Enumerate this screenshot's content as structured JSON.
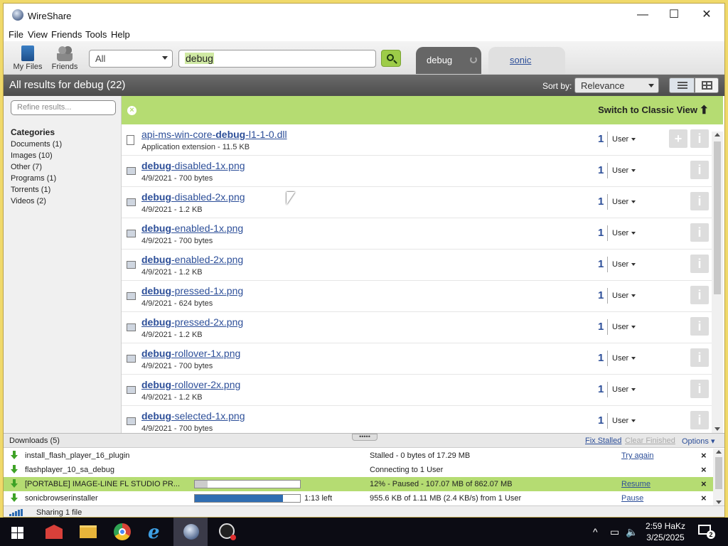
{
  "window": {
    "title": "WireShare",
    "minimize_icon": "—",
    "maximize_icon": "☐",
    "close_icon": "✕"
  },
  "menu": [
    "File",
    "View",
    "Friends",
    "Tools",
    "Help"
  ],
  "toolbar": {
    "my_files_label": "My Files",
    "friends_label": "Friends",
    "filter_value": "All",
    "search_value": "debug",
    "tabs": [
      {
        "label": "debug"
      },
      {
        "label": "sonic"
      }
    ]
  },
  "results_header": {
    "title": "All results for debug (22)",
    "sort_label": "Sort by:",
    "sort_value": "Relevance"
  },
  "sidebar": {
    "refine_placeholder": "Refine results...",
    "categories_title": "Categories",
    "categories": [
      "Documents (1)",
      "Images (10)",
      "Other (7)",
      "Programs (1)",
      "Torrents (1)",
      "Videos (2)"
    ]
  },
  "classic_bar": {
    "label": "Switch to Classic View",
    "close_icon": "×",
    "arrow_icon": "⬆"
  },
  "results": [
    {
      "pre": "api-ms-win-core-",
      "bold": "debug",
      "post": "-l1-1-0.dll",
      "meta": "Application extension - 11.5 KB",
      "count": "1",
      "user": "User",
      "kind": "doc",
      "has_add": true
    },
    {
      "pre": "",
      "bold": "debug",
      "post": "-disabled-1x.png",
      "meta": "4/9/2021 - 700 bytes",
      "count": "1",
      "user": "User",
      "kind": "img",
      "has_add": false
    },
    {
      "pre": "",
      "bold": "debug",
      "post": "-disabled-2x.png",
      "meta": "4/9/2021 - 1.2 KB",
      "count": "1",
      "user": "User",
      "kind": "img",
      "has_add": false
    },
    {
      "pre": "",
      "bold": "debug",
      "post": "-enabled-1x.png",
      "meta": "4/9/2021 - 700 bytes",
      "count": "1",
      "user": "User",
      "kind": "img",
      "has_add": false
    },
    {
      "pre": "",
      "bold": "debug",
      "post": "-enabled-2x.png",
      "meta": "4/9/2021 - 1.2 KB",
      "count": "1",
      "user": "User",
      "kind": "img",
      "has_add": false
    },
    {
      "pre": "",
      "bold": "debug",
      "post": "-pressed-1x.png",
      "meta": "4/9/2021 - 624 bytes",
      "count": "1",
      "user": "User",
      "kind": "img",
      "has_add": false
    },
    {
      "pre": "",
      "bold": "debug",
      "post": "-pressed-2x.png",
      "meta": "4/9/2021 - 1.2 KB",
      "count": "1",
      "user": "User",
      "kind": "img",
      "has_add": false
    },
    {
      "pre": "",
      "bold": "debug",
      "post": "-rollover-1x.png",
      "meta": "4/9/2021 - 700 bytes",
      "count": "1",
      "user": "User",
      "kind": "img",
      "has_add": false
    },
    {
      "pre": "",
      "bold": "debug",
      "post": "-rollover-2x.png",
      "meta": "4/9/2021 - 1.2 KB",
      "count": "1",
      "user": "User",
      "kind": "img",
      "has_add": false
    },
    {
      "pre": "",
      "bold": "debug",
      "post": "-selected-1x.png",
      "meta": "4/9/2021 - 700 bytes",
      "count": "1",
      "user": "User",
      "kind": "img",
      "has_add": false
    }
  ],
  "downloads": {
    "title": "Downloads (5)",
    "fix_stalled": "Fix Stalled",
    "clear_finished": "Clear Finished",
    "options": "Options ▾",
    "items": [
      {
        "name": "install_flash_player_16_plugin",
        "status": "Stalled - 0 bytes of 17.29 MB",
        "action": "Try again",
        "progress": null,
        "time": "",
        "highlight": false
      },
      {
        "name": "flashplayer_10_sa_debug",
        "status": "Connecting to 1 User",
        "action": "",
        "progress": null,
        "time": "",
        "highlight": false
      },
      {
        "name": "[PORTABLE] IMAGE-LINE FL STUDIO PR...",
        "status": "12% - Paused - 107.07 MB of 862.07 MB",
        "action": "Resume",
        "progress": 0.12,
        "time": "",
        "highlight": true
      },
      {
        "name": "sonicbrowserinstaller",
        "status": "955.6 KB of 1.11 MB (2.4 KB/s) from 1 User",
        "action": "Pause",
        "progress": 0.84,
        "time": "1:13 left",
        "highlight": false
      }
    ]
  },
  "status": {
    "text": "Sharing 1 file"
  },
  "taskbar": {
    "time": "2:59 HaKz",
    "date": "3/25/2025",
    "notification_count": "2"
  },
  "colors": {
    "accent_green": "#b5dc72",
    "link_blue": "#2d4f99",
    "progress_blue": "#2f6db2"
  }
}
